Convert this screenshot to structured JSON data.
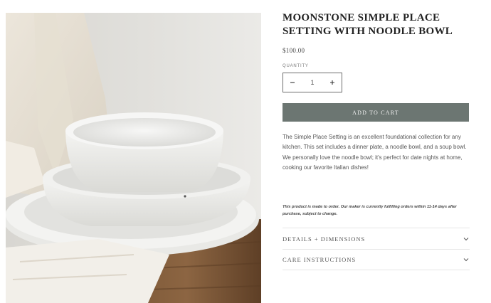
{
  "product": {
    "title": "MOONSTONE SIMPLE PLACE SETTING WITH NOODLE BOWL",
    "price": "$100.00",
    "image_alt": "white ceramic plate, noodle bowl and soup bowl on wood board"
  },
  "quantity": {
    "label": "QUANTITY",
    "value": "1",
    "decrease_icon": "minus-icon",
    "increase_icon": "plus-icon"
  },
  "cart": {
    "add_label": "ADD TO CART",
    "button_color": "#6c7672"
  },
  "description": "The Simple Place Setting is an excellent foundational collection for any kitchen. This set includes a dinner plate, a noodle bowl, and a soup bowl. We personally love the noodle bowl; it's perfect for date nights at home, cooking our favorite Italian dishes!",
  "note": "This product is made to order. Our maker is currently fulfilling orders within 11-14 days after purchase, subject to change.",
  "accordions": [
    {
      "label": "DETAILS + DIMENSIONS",
      "icon": "chevron-down-icon"
    },
    {
      "label": "CARE INSTRUCTIONS",
      "icon": "chevron-down-icon"
    }
  ]
}
